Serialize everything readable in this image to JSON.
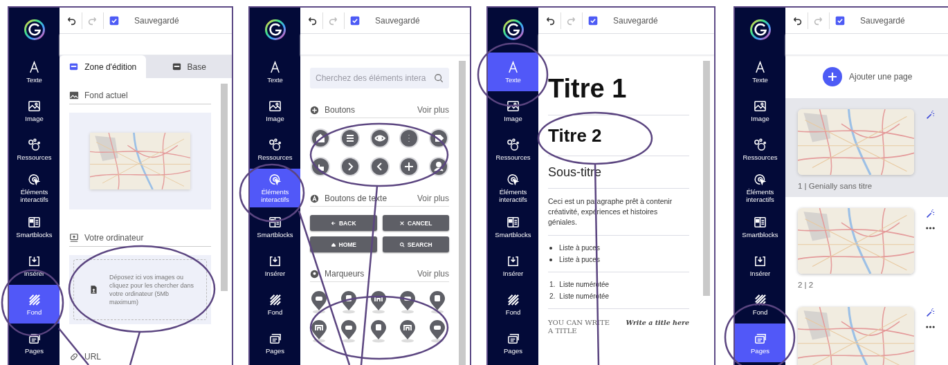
{
  "panels": [
    {
      "kind": "background",
      "status": "Sauvegardé",
      "sidebar": [
        {
          "label": "Texte",
          "selected": false
        },
        {
          "label": "Image",
          "selected": false
        },
        {
          "label": "Ressources",
          "selected": false
        },
        {
          "label": "Éléments interactifs",
          "selected": false
        },
        {
          "label": "Smartblocks",
          "selected": false
        },
        {
          "label": "Insérer",
          "selected": false
        },
        {
          "label": "Fond",
          "selected": true
        },
        {
          "label": "Pages",
          "selected": false
        }
      ],
      "tabs": [
        {
          "label": "Zone d'édition",
          "selected": true
        },
        {
          "label": "Base",
          "selected": false
        }
      ],
      "current_background": {
        "title": "Fond actuel"
      },
      "computer": {
        "title": "Votre ordinateur",
        "dropzone": "Déposez ici vos images ou cliquez pour les chercher dans votre ordinateur (5Mb maximum)"
      },
      "url": {
        "title": "URL"
      }
    },
    {
      "kind": "interactive",
      "status": "Sauvegardé",
      "sidebar": [
        {
          "label": "Texte",
          "selected": false
        },
        {
          "label": "Image",
          "selected": false
        },
        {
          "label": "Ressources",
          "selected": false
        },
        {
          "label": "Éléments interactifs",
          "selected": true
        },
        {
          "label": "Smartblocks",
          "selected": false
        },
        {
          "label": "Insérer",
          "selected": false
        },
        {
          "label": "Fond",
          "selected": false
        },
        {
          "label": "Pages",
          "selected": false
        }
      ],
      "search": {
        "placeholder": "Cherchez des éléments intera"
      },
      "sections": [
        {
          "kind": "icon_buttons",
          "title": "Boutons",
          "more": "Voir plus"
        },
        {
          "kind": "text_buttons",
          "title": "Boutons de texte",
          "more": "Voir plus",
          "buttons": [
            "BACK",
            "CANCEL",
            "HOME",
            "SEARCH"
          ]
        },
        {
          "kind": "markers",
          "title": "Marqueurs",
          "more": "Voir plus"
        }
      ]
    },
    {
      "kind": "text",
      "status": "Sauvegardé",
      "sidebar": [
        {
          "label": "Texte",
          "selected": true
        },
        {
          "label": "Image",
          "selected": false
        },
        {
          "label": "Ressources",
          "selected": false
        },
        {
          "label": "Éléments interactifs",
          "selected": false
        },
        {
          "label": "Smartblocks",
          "selected": false
        },
        {
          "label": "Insérer",
          "selected": false
        },
        {
          "label": "Fond",
          "selected": false
        },
        {
          "label": "Pages",
          "selected": false
        }
      ],
      "blocks": [
        {
          "kind": "h1",
          "text": "Titre 1"
        },
        {
          "kind": "h2",
          "text": "Titre 2"
        },
        {
          "kind": "subtitle",
          "text": "Sous-titre"
        },
        {
          "kind": "paragraph",
          "text": "Ceci est un paragraphe prêt à contenir créativité, expériences et histoires géniales."
        },
        {
          "kind": "bullets",
          "items": [
            "Liste à puces",
            "Liste à puces"
          ]
        },
        {
          "kind": "numbered",
          "items": [
            {
              "number": "1.",
              "text": "Liste numérotée"
            },
            {
              "number": "2.",
              "text": "Liste numérotée"
            }
          ]
        },
        {
          "kind": "templates",
          "items": [
            "YOU CAN WRITE A TITLE",
            "Write a title here"
          ]
        }
      ]
    },
    {
      "kind": "pages",
      "status": "Sauvegardé",
      "sidebar": [
        {
          "label": "Texte",
          "selected": false
        },
        {
          "label": "Image",
          "selected": false
        },
        {
          "label": "Ressources",
          "selected": false
        },
        {
          "label": "Éléments interactifs",
          "selected": false
        },
        {
          "label": "Smartblocks",
          "selected": false
        },
        {
          "label": "Insérer",
          "selected": false
        },
        {
          "label": "Fond",
          "selected": false
        },
        {
          "label": "Pages",
          "selected": true
        }
      ],
      "add_label": "Ajouter une page",
      "pages": [
        {
          "label": "1 | Genially sans titre",
          "selected": true
        },
        {
          "label": "2 | 2",
          "selected": false
        },
        {
          "selected": false
        }
      ]
    }
  ]
}
